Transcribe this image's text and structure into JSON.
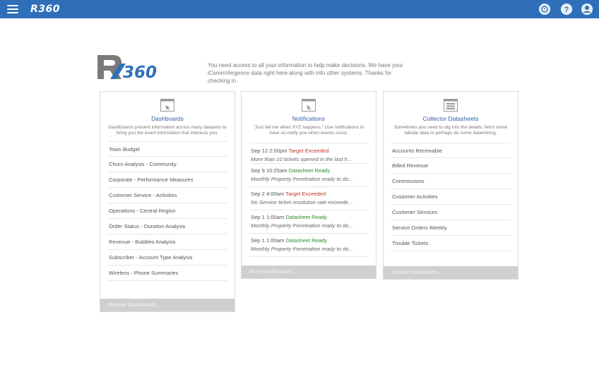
{
  "header": {
    "brand": "R360",
    "icons": [
      "menu-icon",
      "notification-icon",
      "help-icon",
      "user-icon"
    ]
  },
  "intro": {
    "logo_text": "R360",
    "text": "You need access to all your information to help make decisions. We have your iCommVergence data right here along with info other systems. Thanks for checking in."
  },
  "dashboards": {
    "title": "Dashboards",
    "description": "Dashboards present information across many datasets to bring you the exact information that interests you.",
    "items": [
      "Town Budget",
      "Churn Analysis - Community",
      "Corporate - Performance Measures",
      "Customer Service - Activities",
      "Operations - Central Region",
      "Order Status - Duration Analysis",
      "Revenue - Bubbles Analysis",
      "Subscriber - Account Type Analysis",
      "Wireless - Phone Summaries"
    ],
    "footer": "Browse Dashboards..."
  },
  "notifications": {
    "title": "Notifications",
    "description": "\"Just tell me when XYZ happens.\" Use notifications to have us notify you when events occur.",
    "items": [
      {
        "time": "Sep 12 2:00pm",
        "status": "Target Exceeded",
        "message": "More than 10 tickets opened in the last h..."
      },
      {
        "time": "Sep 9 10:25am",
        "status": "Datasheet Ready",
        "message": "Monthly Property Penetration ready to do..."
      },
      {
        "time": "Sep 2 4:00am",
        "status": "Target Exceeded",
        "message": "No Service ticket resolution rate exceede..."
      },
      {
        "time": "Sep 1 1:00am",
        "status": "Datasheet Ready",
        "message": "Monthly Property Penetration ready to do..."
      },
      {
        "time": "Sep 1 1:00am",
        "status": "Datasheet Ready",
        "message": "Monthly Property Penetration ready to do..."
      }
    ],
    "footer": "More Notifications..."
  },
  "datasheets": {
    "title": "Collector Datasheets",
    "description": "Sometimes you need to dig into the details, fetch some tabular data or perhaps do some datamining.",
    "items": [
      "Accounts Receivable",
      "Billed Revenue",
      "Commissions",
      "Customer Activities",
      "Customer Services",
      "Service Orders Weekly",
      "Trouble Tickets"
    ],
    "footer": "Browse Datasheets..."
  },
  "colors": {
    "header": "#2f6fba",
    "title": "#2f5f9e",
    "target_exceeded": "#c0392b",
    "datasheet_ready": "#2e8b30"
  }
}
